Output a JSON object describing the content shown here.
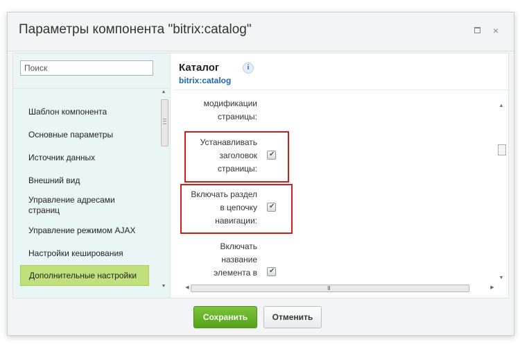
{
  "dialog": {
    "title": "Параметры компонента \"bitrix:catalog\"",
    "maximize_glyph": "□",
    "close_glyph": "×"
  },
  "sidebar": {
    "search_placeholder": "Поиск",
    "items": [
      {
        "label": "Шаблон компонента",
        "active": false
      },
      {
        "label": "Основные параметры",
        "active": false
      },
      {
        "label": "Источник данных",
        "active": false
      },
      {
        "label": "Внешний вид",
        "active": false
      },
      {
        "label": "Управление адресами страниц",
        "active": false
      },
      {
        "label": "Управление режимом AJAX",
        "active": false
      },
      {
        "label": "Настройки кеширования",
        "active": false
      },
      {
        "label": "Дополнительные настройки",
        "active": true
      }
    ]
  },
  "content": {
    "title": "Каталог",
    "subtitle": "bitrix:catalog",
    "info_glyph": "i",
    "params": [
      {
        "label": "модификации\nстраницы:",
        "checkbox": false
      },
      {
        "label": "Устанавливать\nзаголовок\nстраницы:",
        "checkbox": true,
        "checked": true,
        "highlighted": true
      },
      {
        "label": "Включать раздел\nв цепочку\nнавигации:",
        "checkbox": true,
        "checked": true,
        "highlighted": true
      },
      {
        "label": "Включать\nназвание\nэлемента в",
        "checkbox": true,
        "checked": true,
        "highlighted": false
      }
    ],
    "hscroll_grip": "III"
  },
  "footer": {
    "save_label": "Сохранить",
    "cancel_label": "Отменить"
  },
  "colors": {
    "highlight_box": "#d01c1c",
    "active_item": "#bfe07a",
    "save_button": "#6ab42c",
    "subtitle": "#2067b0"
  },
  "icons": {
    "maximize": "maximize-icon",
    "close": "close-icon",
    "info": "info-icon",
    "checkbox": "checkbox-checked"
  }
}
